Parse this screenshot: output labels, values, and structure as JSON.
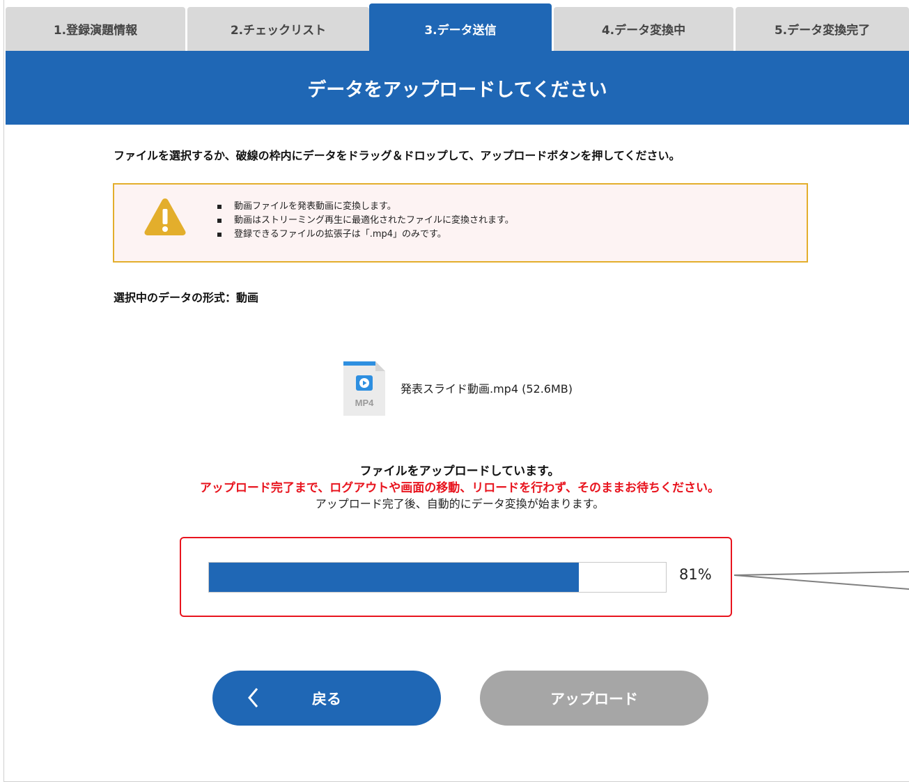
{
  "tabs": [
    {
      "label": "1.登録演題情報"
    },
    {
      "label": "2.チェックリスト"
    },
    {
      "label": "3.データ送信"
    },
    {
      "label": "4.データ変換中"
    },
    {
      "label": "5.データ変換完了"
    }
  ],
  "active_tab": 2,
  "banner": {
    "title": "データをアップロードしてください"
  },
  "instruction": "ファイルを選択するか、破線の枠内にデータをドラッグ＆ドロップして、アップロードボタンを押してください。",
  "notice": {
    "icon": "warning-icon",
    "items": [
      "動画ファイルを発表動画に変換します。",
      "動画はストリーミング再生に最適化されたファイルに変換されます。",
      "登録できるファイルの拡張子は「.mp4」のみです。"
    ]
  },
  "format": {
    "label": "選択中のデータの形式：",
    "value": "動画"
  },
  "file": {
    "icon": "mp4-file-icon",
    "icon_text": "MP4",
    "name": "発表スライド動画.mp4 (52.6MB)"
  },
  "status": {
    "line1": "ファイルをアップロードしています。",
    "line2": "アップロード完了まで、ログアウトや画面の移動、リロードを行わず、そのままお待ちください。",
    "line3": "アップロード完了後、自動的にデータ変換が始まります。"
  },
  "progress": {
    "value": 0.81,
    "label": "81%"
  },
  "buttons": {
    "back": "戻る",
    "upload": "アップロード"
  },
  "colors": {
    "primary": "#1f67b5",
    "warning": "#e3ae2c",
    "alert": "#e8141e",
    "disabled": "#a6a6a6"
  }
}
